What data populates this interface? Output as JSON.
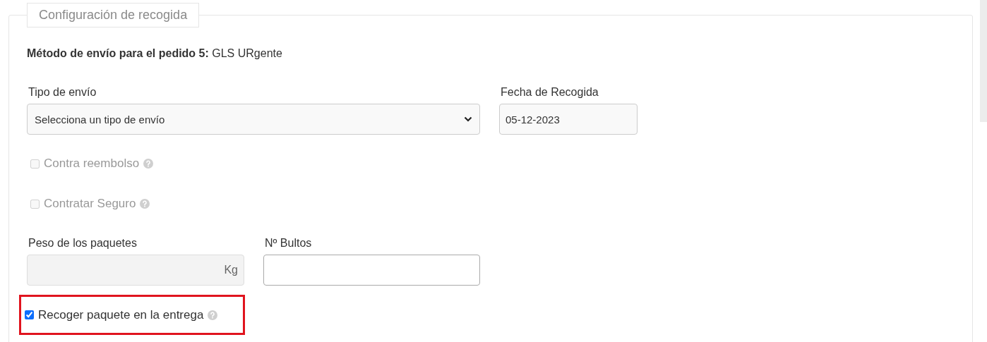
{
  "panel": {
    "legend": "Configuración de recogida",
    "shipping_method": "**Método de envío para el pedido 5:** GLS URgente",
    "shipping_type": {
      "label": "Tipo de envío",
      "value": "Selecciona un tipo de envío"
    },
    "pickup_date": {
      "label": "Fecha de Recogida",
      "value": "05-12-2023"
    },
    "items": [
      {
        "kind": "checkbox",
        "label": "Contra reembolso",
        "checked": false,
        "disabled": true,
        "highlighted": false
      },
      {
        "kind": "checkbox",
        "label": "Contratar Seguro",
        "checked": false,
        "disabled": true,
        "highlighted": false
      },
      {
        "kind": "fields",
        "fields": [
          {
            "label": "Peso de los paquetes",
            "unit": "Kg",
            "disabled": true
          },
          {
            "label": "Nº Bultos",
            "disabled": false
          }
        ]
      },
      {
        "kind": "checkbox",
        "label": "Recoger paquete en la entrega",
        "checked": true,
        "disabled": false,
        "highlighted": true
      }
    ]
  }
}
